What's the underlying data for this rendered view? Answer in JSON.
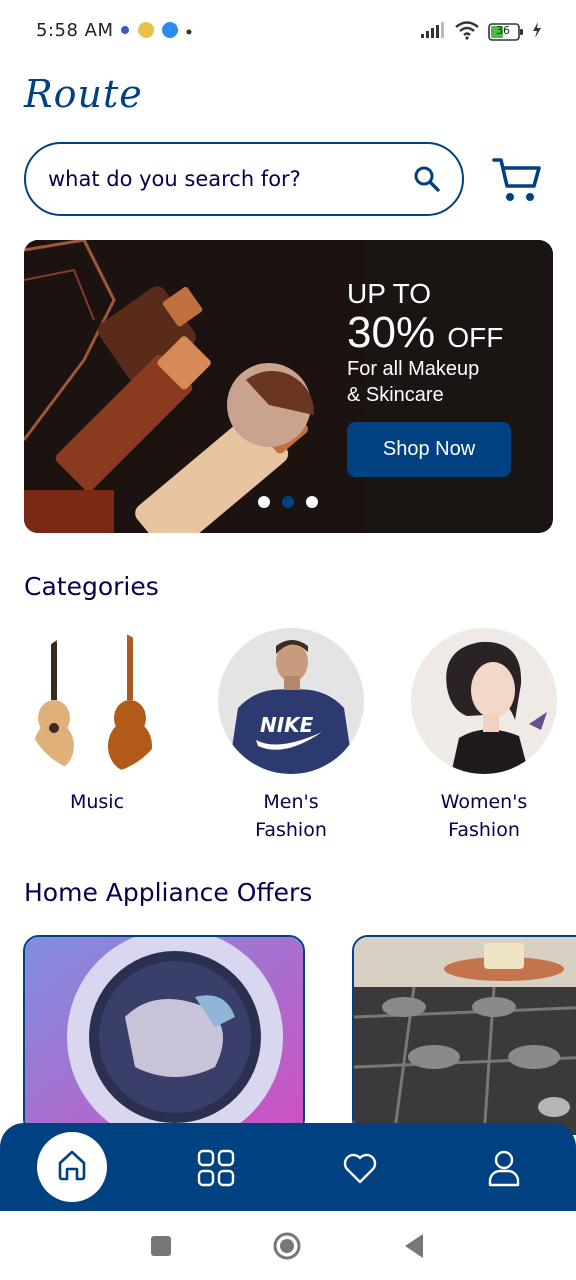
{
  "status_bar": {
    "time": "5:58 AM",
    "battery": "36",
    "icons": [
      "settings-dot-icon",
      "emoji-icon",
      "video-call-icon",
      "signal-icon",
      "wifi-icon",
      "battery-icon",
      "charging-icon"
    ]
  },
  "header": {
    "logo": "Route"
  },
  "search": {
    "placeholder": "what do you search for?"
  },
  "banner": {
    "headline_top": "UP TO",
    "headline_pct": "30%",
    "headline_off": "OFF",
    "subtitle_line1": "For all Makeup",
    "subtitle_line2": "& Skincare",
    "button_label": "Shop Now",
    "slides": 3,
    "active_slide": 2
  },
  "categories": {
    "title": "Categories",
    "items": [
      {
        "label_line1": "Music",
        "label_line2": ""
      },
      {
        "label_line1": "Men's",
        "label_line2": "Fashion"
      },
      {
        "label_line1": "Women's",
        "label_line2": "Fashion"
      }
    ]
  },
  "offers": {
    "title": "Home Appliance Offers"
  },
  "bottom_nav": {
    "items": [
      "home-icon",
      "categories-icon",
      "wishlist-icon",
      "profile-icon"
    ],
    "active": "home-icon"
  },
  "colors": {
    "primary": "#004182",
    "text_dark": "#06004f",
    "banner_bg": "#1a1412"
  }
}
